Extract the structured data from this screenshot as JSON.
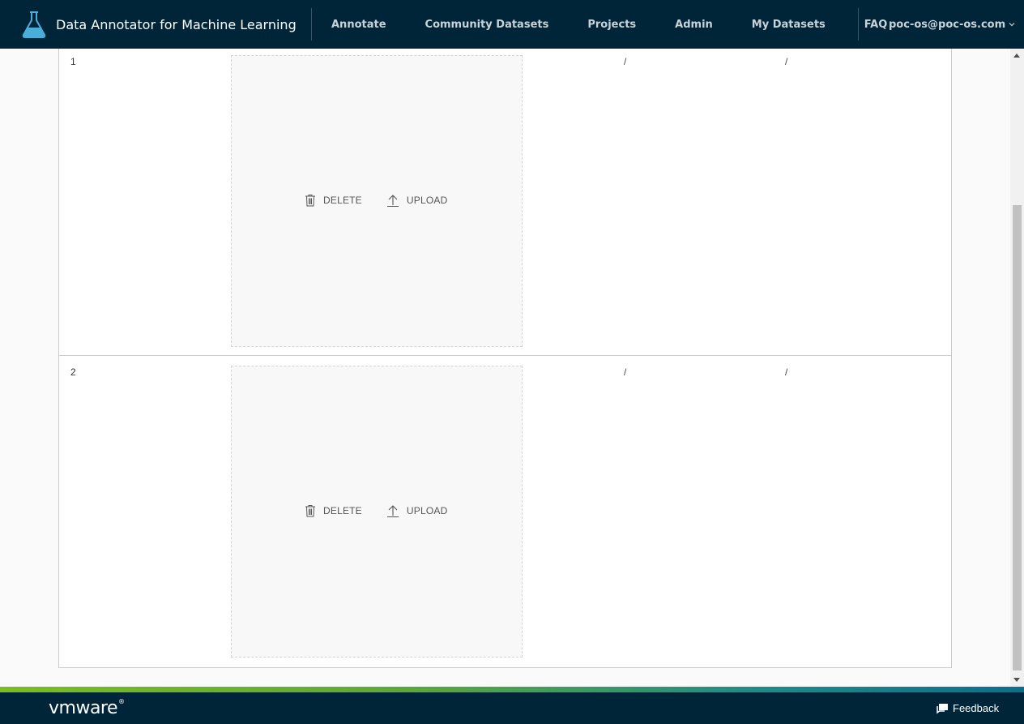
{
  "header": {
    "title": "Data Annotator for Machine Learning",
    "nav": [
      {
        "label": "Annotate"
      },
      {
        "label": "Community Datasets"
      },
      {
        "label": "Projects"
      },
      {
        "label": "Admin"
      },
      {
        "label": "My Datasets"
      },
      {
        "label": "FAQ"
      }
    ],
    "user": "poc-os@poc-os.com"
  },
  "rows": [
    {
      "index": "1",
      "delete_label": "DELETE",
      "upload_label": "UPLOAD",
      "col_a": "/",
      "col_b": "/"
    },
    {
      "index": "2",
      "delete_label": "DELETE",
      "upload_label": "UPLOAD",
      "col_a": "/",
      "col_b": "/"
    }
  ],
  "footer": {
    "logo_text": "vmware",
    "feedback_label": "Feedback"
  },
  "colors": {
    "header_bg": "#002538",
    "accent_blue": "#49afd9",
    "stripe_green": "#78be20"
  },
  "icons": {
    "logo": "flask-icon",
    "delete": "trash-icon",
    "upload": "upload-arrow-icon",
    "user_menu": "chevron-down-icon",
    "feedback": "feedback-icon"
  }
}
